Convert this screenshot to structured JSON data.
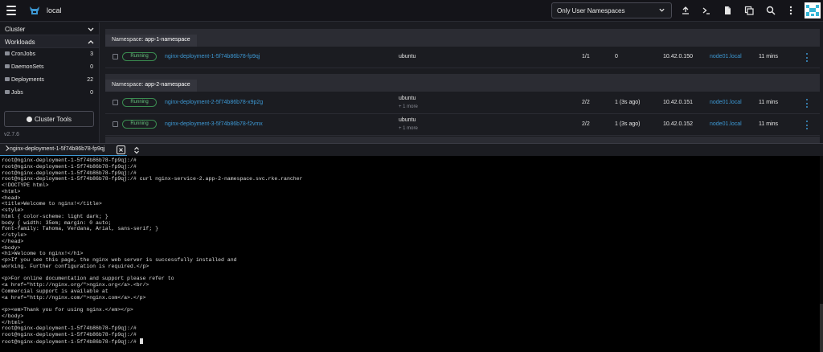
{
  "header": {
    "cluster_name": "local",
    "namespace_filter": "Only User Namespaces",
    "icons": [
      "import-yaml-icon",
      "kubectl-shell-icon",
      "kubeconfig-download-icon",
      "copy-kubeconfig-icon",
      "search-icon",
      "more-vertical-icon"
    ]
  },
  "sidebar": {
    "groups": [
      {
        "label": "Cluster"
      },
      {
        "label": "Workloads"
      }
    ],
    "items": [
      {
        "label": "CronJobs",
        "count": "3"
      },
      {
        "label": "DaemonSets",
        "count": "0"
      },
      {
        "label": "Deployments",
        "count": "22"
      },
      {
        "label": "Jobs",
        "count": "0"
      }
    ],
    "cluster_tools": "Cluster Tools",
    "version": "v2.7.6"
  },
  "namespaces": [
    {
      "prefix": "Namespace:",
      "name": "app-1-namespace"
    },
    {
      "prefix": "Namespace:",
      "name": "app-2-namespace"
    }
  ],
  "pods": [
    {
      "state": "Running",
      "name": "nginx-deployment-1-5f74b86b78-fp9qj",
      "image": "ubuntu",
      "more": "",
      "ready": "1/1",
      "restarts": "0",
      "ip": "10.42.0.150",
      "node": "node01.local",
      "age": "11 mins"
    },
    {
      "state": "Running",
      "name": "nginx-deployment-2-5f74b86b78-x9p2g",
      "image": "ubuntu",
      "more": "+ 1 more",
      "ready": "2/2",
      "restarts": "1 (3s ago)",
      "ip": "10.42.0.151",
      "node": "node01.local",
      "age": "11 mins"
    },
    {
      "state": "Running",
      "name": "nginx-deployment-3-5f74b86b78-f2vmx",
      "image": "ubuntu",
      "more": "+ 1 more",
      "ready": "2/2",
      "restarts": "1 (3s ago)",
      "ip": "10.42.0.152",
      "node": "node01.local",
      "age": "11 mins"
    }
  ],
  "terminal": {
    "tab_title": "nginx-deployment-1-5f74b86b78-fp9qj",
    "lines": [
      "root@nginx-deployment-1-5f74b86b78-fp9qj:/#",
      "root@nginx-deployment-1-5f74b86b78-fp9qj:/#",
      "root@nginx-deployment-1-5f74b86b78-fp9qj:/#",
      "root@nginx-deployment-1-5f74b86b78-fp9qj:/# curl nginx-service-2.app-2-namespace.svc.rke.rancher",
      "<!DOCTYPE html>",
      "<html>",
      "<head>",
      "<title>Welcome to nginx!</title>",
      "<style>",
      "html { color-scheme: light dark; }",
      "body { width: 35em; margin: 0 auto;",
      "font-family: Tahoma, Verdana, Arial, sans-serif; }",
      "</style>",
      "</head>",
      "<body>",
      "<h1>Welcome to nginx!</h1>",
      "<p>If you see this page, the nginx web server is successfully installed and",
      "working. Further configuration is required.</p>",
      "",
      "<p>For online documentation and support please refer to",
      "<a href=\"http://nginx.org/\">nginx.org</a>.<br/>",
      "Commercial support is available at",
      "<a href=\"http://nginx.com/\">nginx.com</a>.</p>",
      "",
      "<p><em>Thank you for using nginx.</em></p>",
      "</body>",
      "</html>",
      "root@nginx-deployment-1-5f74b86b78-fp9qj:/#",
      "root@nginx-deployment-1-5f74b86b78-fp9qj:/#",
      "root@nginx-deployment-1-5f74b86b78-fp9qj:/# "
    ]
  }
}
